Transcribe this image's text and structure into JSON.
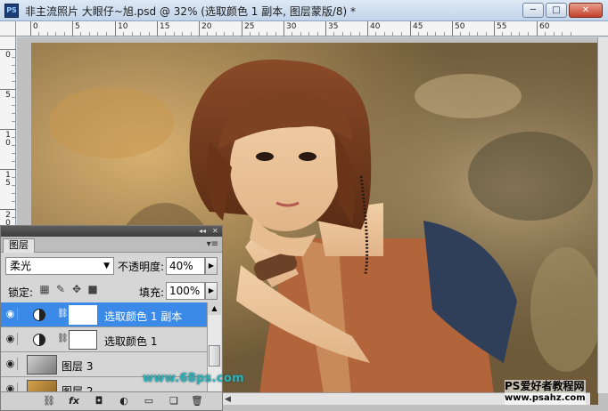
{
  "window": {
    "title": "非主流照片 大眼仔~旭.psd @ 32% (选取颜色 1 副本, 图层蒙版/8) *",
    "app_icon": "PS",
    "minimize_glyph": "─",
    "maximize_glyph": "□",
    "close_glyph": "✕"
  },
  "rulers": {
    "top_labels": [
      "0",
      "5",
      "10",
      "15",
      "20",
      "25",
      "30",
      "35",
      "40",
      "45",
      "50",
      "55",
      "60"
    ],
    "left_labels": [
      "0",
      "5",
      "1\n0",
      "1\n5",
      "2\n0"
    ]
  },
  "layers_panel": {
    "collapse_glyph": "◂◂",
    "close_glyph": "✕",
    "tab_label": "图层",
    "menu_glyph": "▾≡",
    "blend_mode": "柔光",
    "opacity_label": "不透明度:",
    "opacity_value": "40%",
    "lock_label": "锁定:",
    "fill_label": "填充:",
    "fill_value": "100%",
    "layers": [
      {
        "name": "选取颜色 1 副本",
        "selected": true,
        "type": "adjustment"
      },
      {
        "name": "选取颜色 1",
        "selected": false,
        "type": "adjustment"
      },
      {
        "name": "图层 3",
        "selected": false,
        "type": "image"
      },
      {
        "name": "图层 2",
        "selected": false,
        "type": "image"
      }
    ],
    "footer_icons": [
      "link-icon",
      "fx-icon",
      "mask-icon",
      "adjustment-icon",
      "group-icon",
      "new-layer-icon",
      "trash-icon"
    ],
    "footer_glyphs": [
      "⛓",
      "fx",
      "◘",
      "◐",
      "▭",
      "❏",
      "🗑"
    ]
  },
  "watermarks": {
    "site": "www.68ps.com",
    "ps": "PS爱好者教程网",
    "ps_url": "www.psahz.com"
  },
  "colors": {
    "selection": "#3b8ae8",
    "titlebar": "#c3d5ea",
    "watermark_teal": "#2fb0b8"
  }
}
